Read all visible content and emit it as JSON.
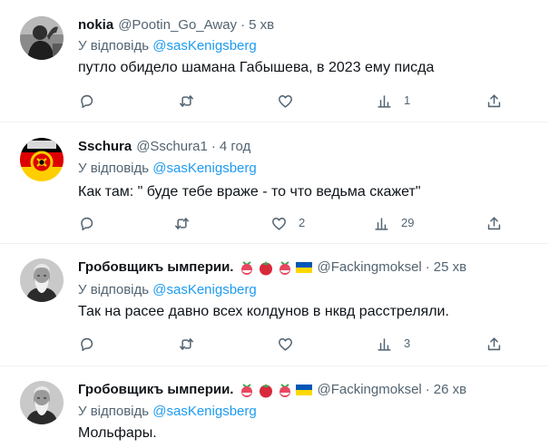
{
  "reply_prefix": "У відповідь",
  "separator": "·",
  "tweets": [
    {
      "name": "nokia",
      "handle": "@Pootin_Go_Away",
      "time": "5 хв",
      "reply_to": "@sasKenigsberg",
      "text": "путло обидело шамана Габышева, в 2023 ему писда",
      "replies": "",
      "retweets": "",
      "likes": "",
      "views": "1",
      "avatar_icon": "bw-photo-person"
    },
    {
      "name": "Sschura",
      "handle": "@Sschura1",
      "time": "4 год",
      "reply_to": "@sasKenigsberg",
      "text": "Как там: \" буде тебе враже - то что ведьма скажет\"",
      "replies": "",
      "retweets": "",
      "likes": "2",
      "views": "29",
      "avatar_icon": "gdr-flag-emblem",
      "colors": {
        "black": "#000000",
        "red": "#dd0000",
        "gold": "#ffce00"
      }
    },
    {
      "name": "Гробовщикъ ымперии.",
      "handle": "@Fackingmoksel",
      "time": "25 хв",
      "reply_to": "@sasKenigsberg",
      "text": "Так на расее давно всех колдунов в нквд расстреляли.",
      "replies": "",
      "retweets": "",
      "likes": "",
      "views": "3",
      "avatar_icon": "old-man-portrait",
      "name_emojis": [
        "radish-emoji",
        "tomato-emoji",
        "radish-emoji",
        "ukraine-flag-emoji"
      ]
    },
    {
      "name": "Гробовщикъ ымперии.",
      "handle": "@Fackingmoksel",
      "time": "26 хв",
      "reply_to": "@sasKenigsberg",
      "text": "Мольфары.",
      "avatar_icon": "old-man-portrait",
      "name_emojis": [
        "radish-emoji",
        "tomato-emoji",
        "radish-emoji",
        "ukraine-flag-emoji"
      ]
    }
  ],
  "icons": {
    "reply": "reply-icon",
    "retweet": "retweet-icon",
    "like": "heart-icon",
    "views": "views-icon",
    "share": "share-icon"
  },
  "colors": {
    "text": "#0f1419",
    "secondary": "#536471",
    "link": "#1d9bf0",
    "divider": "#eff3f4",
    "ukraine_blue": "#0057b7",
    "ukraine_yellow": "#ffd700"
  }
}
